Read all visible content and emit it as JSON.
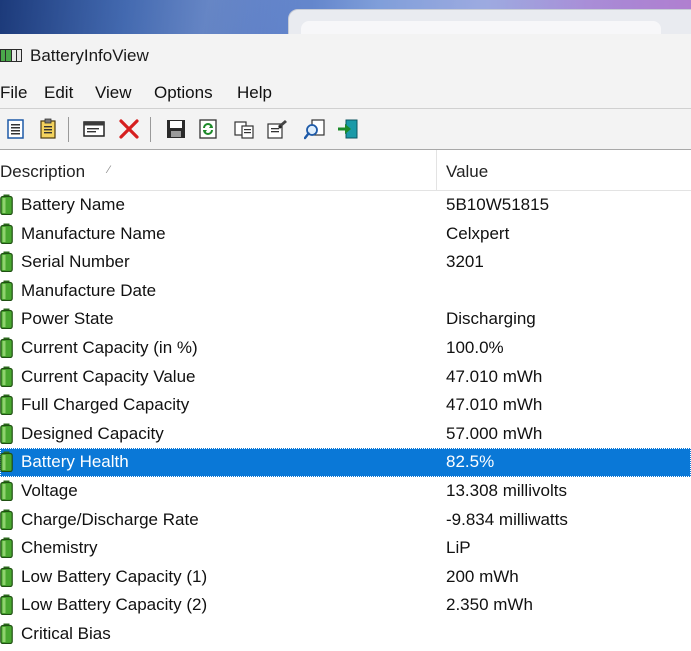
{
  "window": {
    "title": "BatteryInfoView"
  },
  "menu": [
    "File",
    "Edit",
    "View",
    "Options",
    "Help"
  ],
  "toolbar": {
    "icons": [
      "html-report-all-icon",
      "html-report-selected-icon",
      "properties-window-icon",
      "delete-icon",
      "save-icon",
      "refresh-icon",
      "copy-icon",
      "properties-icon",
      "find-icon",
      "exit-icon"
    ]
  },
  "table": {
    "columns": {
      "description": "Description",
      "value": "Value"
    },
    "sort_indicator": "⁄",
    "selected_index": 9,
    "rows": [
      {
        "description": "Battery Name",
        "value": "5B10W51815"
      },
      {
        "description": "Manufacture Name",
        "value": "Celxpert"
      },
      {
        "description": "Serial Number",
        "value": " 3201"
      },
      {
        "description": "Manufacture Date",
        "value": ""
      },
      {
        "description": "Power State",
        "value": "Discharging"
      },
      {
        "description": "Current Capacity (in %)",
        "value": "100.0%"
      },
      {
        "description": "Current Capacity Value",
        "value": "47.010 mWh"
      },
      {
        "description": "Full Charged Capacity",
        "value": "47.010 mWh"
      },
      {
        "description": "Designed Capacity",
        "value": "57.000 mWh"
      },
      {
        "description": "Battery Health",
        "value": "82.5%"
      },
      {
        "description": "Voltage",
        "value": "13.308 millivolts"
      },
      {
        "description": "Charge/Discharge Rate",
        "value": "-9.834 milliwatts"
      },
      {
        "description": "Chemistry",
        "value": "LiP"
      },
      {
        "description": "Low Battery Capacity (1)",
        "value": "200 mWh"
      },
      {
        "description": "Low Battery Capacity (2)",
        "value": "2.350 mWh"
      },
      {
        "description": "Critical Bias",
        "value": ""
      }
    ]
  },
  "colors": {
    "selection": "#0a78d7",
    "battery_green": "#3f9a2c"
  }
}
